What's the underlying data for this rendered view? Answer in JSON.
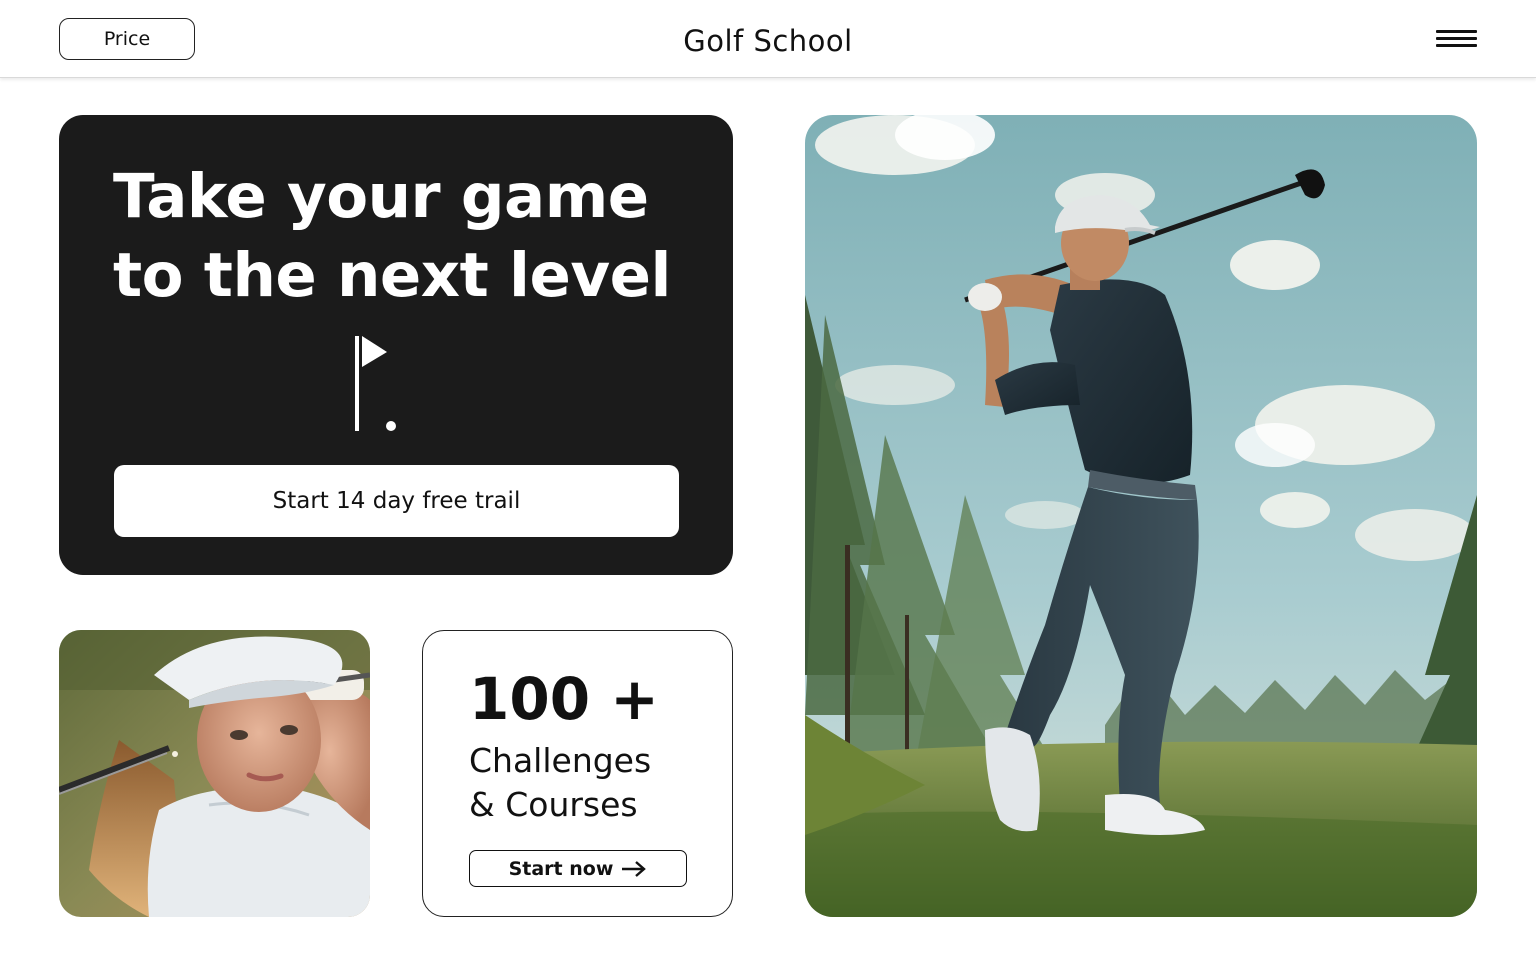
{
  "header": {
    "price_label": "Price",
    "brand": "Golf School",
    "menu_icon": "hamburger-menu-icon"
  },
  "hero": {
    "title_line1": "Take your game",
    "title_line2": "to the next level",
    "flag_icon": "golf-flag-icon",
    "cta_label": "Start 14 day free trail"
  },
  "stats": {
    "number": "100 +",
    "label_line1": "Challenges",
    "label_line2": "& Courses",
    "cta_label": "Start now",
    "cta_icon": "arrow-right-icon"
  },
  "colors": {
    "card_dark": "#1b1b1b",
    "text": "#111111",
    "background": "#ffffff"
  }
}
